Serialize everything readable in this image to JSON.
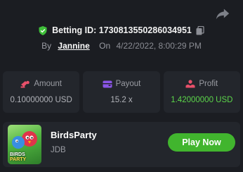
{
  "bet": {
    "label": "Betting ID:",
    "id": "1730813550286034951",
    "by_label": "By",
    "user": "Jannine",
    "on_label": "On",
    "date": "4/22/2022, 8:00:29 PM"
  },
  "stats": [
    {
      "label": "Amount",
      "value": "0.10000000 USD",
      "icon": "coins-icon"
    },
    {
      "label": "Payout",
      "value": "15.2 x",
      "icon": "wallet-icon"
    },
    {
      "label": "Profit",
      "value": "1.42000000 USD",
      "icon": "profit-icon"
    }
  ],
  "game": {
    "name": "BirdsParty",
    "provider": "JDB",
    "thumb_text_1": "BIRDS",
    "thumb_text_2": "PARTY",
    "play_label": "Play Now"
  },
  "colors": {
    "background": "#1b1d22",
    "card": "#23262c",
    "accent_green": "#41b52e",
    "profit_green": "#5cd64a",
    "amount_icon": "#e8506a",
    "payout_icon": "#8a55e6",
    "profit_icon": "#e8506a"
  }
}
